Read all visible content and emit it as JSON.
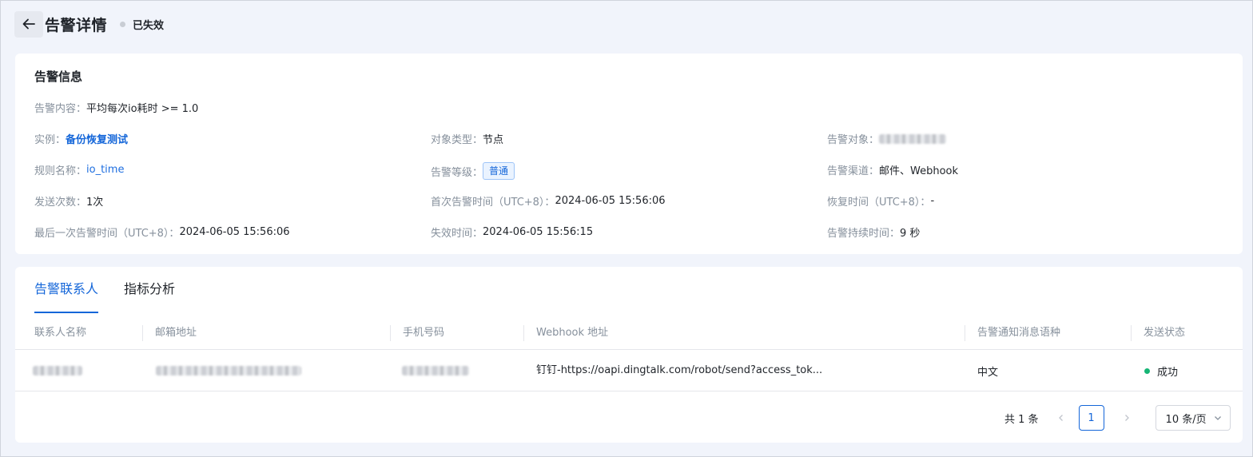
{
  "header": {
    "title": "告警详情",
    "status": "已失效",
    "back_icon": "arrow-left-icon"
  },
  "info": {
    "section_title": "告警信息",
    "content_label": "告警内容：",
    "content_value": "平均每次io耗时 >= 1.0",
    "instance_label": "实例：",
    "instance_value": "备份恢复测试",
    "object_type_label": "对象类型：",
    "object_type_value": "节点",
    "alert_object_label": "告警对象：",
    "rule_label": "规则名称：",
    "rule_value": "io_time",
    "level_label": "告警等级：",
    "level_value": "普通",
    "channel_label": "告警渠道：",
    "channel_value": "邮件、Webhook",
    "send_count_label": "发送次数：",
    "send_count_value": "1次",
    "first_time_label": "首次告警时间（UTC+8）：",
    "first_time_value": "2024-06-05 15:56:06",
    "recover_label": "恢复时间（UTC+8）：",
    "recover_value": "-",
    "last_time_label": "最后一次告警时间（UTC+8）：",
    "last_time_value": "2024-06-05 15:56:06",
    "expire_label": "失效时间：",
    "expire_value": "2024-06-05 15:56:15",
    "duration_label": "告警持续时间：",
    "duration_value": "9 秒"
  },
  "tabs": [
    {
      "label": "告警联系人",
      "active": true
    },
    {
      "label": "指标分析",
      "active": false
    }
  ],
  "table": {
    "columns": [
      "联系人名称",
      "邮箱地址",
      "手机号码",
      "Webhook 地址",
      "告警通知消息语种",
      "发送状态"
    ],
    "rows": [
      {
        "webhook": "钉钉-https://oapi.dingtalk.com/robot/send?access_tok...",
        "language": "中文",
        "status": "成功"
      }
    ]
  },
  "pagination": {
    "total": "共 1 条",
    "current_page": "1",
    "page_size": "10 条/页"
  },
  "colors": {
    "accent": "#1466d9",
    "success": "#16b575",
    "inactive_dot": "#c9cdd4"
  }
}
